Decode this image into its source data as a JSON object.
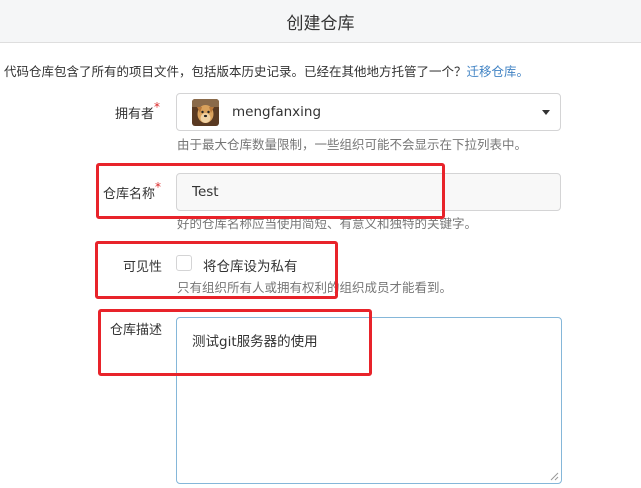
{
  "header": {
    "title": "创建仓库"
  },
  "intro": {
    "text": "代码仓库包含了所有的项目文件，包括版本历史记录。已经在其他地方托管了一个？",
    "link_label": "迁移仓库。"
  },
  "owner": {
    "label": "拥有者",
    "required_mark": "*",
    "value": "mengfanxing",
    "helper": "由于最大仓库数量限制，一些组织可能不会显示在下拉列表中。",
    "avatar_icon": "avatar-photo",
    "dropdown_icon": "caret-down-icon"
  },
  "repo_name": {
    "label": "仓库名称",
    "required_mark": "*",
    "value": "Test",
    "helper": "好的仓库名称应当使用简短、有意义和独特的关键字。"
  },
  "visibility": {
    "label": "可见性",
    "checkbox_label": "将仓库设为私有",
    "checked": false,
    "helper": "只有组织所有人或拥有权利的组织成员才能看到。"
  },
  "description": {
    "label": "仓库描述",
    "value": "测试git服务器的使用"
  },
  "colors": {
    "annotation_red": "#e8232a",
    "link": "#4183c4",
    "focus_border": "#85b7d9",
    "required": "#db2828"
  }
}
